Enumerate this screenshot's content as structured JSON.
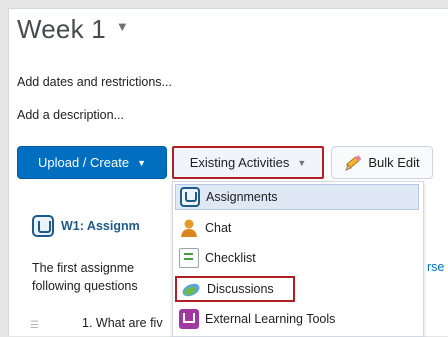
{
  "week": {
    "title": "Week 1",
    "caret_icon": "caret-down-icon"
  },
  "links": {
    "dates": "Add dates and restrictions...",
    "description": "Add a description..."
  },
  "toolbar": {
    "upload_label": "Upload / Create",
    "existing_label": "Existing Activities",
    "bulk_label": "Bulk Edit"
  },
  "topic": {
    "title": "W1: Assignm",
    "text_line1": "The first assignme",
    "text_line2": "following questions",
    "right_fragment": "rse",
    "question": "1. What are fiv"
  },
  "menu": {
    "items": [
      {
        "label": "Assignments",
        "icon": "assignment-icon"
      },
      {
        "label": "Chat",
        "icon": "chat-icon"
      },
      {
        "label": "Checklist",
        "icon": "checklist-icon"
      },
      {
        "label": "Discussions",
        "icon": "discussions-icon"
      },
      {
        "label": "External Learning Tools",
        "icon": "external-tools-icon"
      }
    ]
  },
  "colors": {
    "primary_button": "#006fbf",
    "highlight_border": "#b01f24",
    "assignment_blue": "#1e5a8a",
    "menu_highlight": "#dfe8f5"
  }
}
